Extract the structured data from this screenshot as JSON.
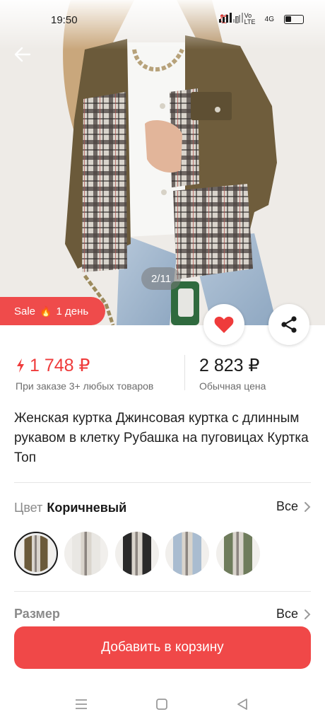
{
  "status_bar": {
    "time": "19:50",
    "network_label": "4G",
    "volte_label": "Vo LTE"
  },
  "hero": {
    "image_counter": "2/11",
    "sale_label": "Sale",
    "sale_duration": "1 день"
  },
  "prices": {
    "promo_price": "1 748 ₽",
    "promo_caption": "При заказе 3+ любых товаров",
    "regular_price": "2 823 ₽",
    "regular_caption": "Обычная цена",
    "accent_color": "#ef3b3b"
  },
  "product": {
    "title": "Женская куртка Джинсовая куртка с длинным рукавом в клетку Рубашка на пуговицах Куртка Топ"
  },
  "color_section": {
    "label": "Цвет",
    "selected_value": "Коричневый",
    "all_label": "Все",
    "swatches": [
      {
        "name": "brown",
        "color": "#6b5a3a",
        "selected": true
      },
      {
        "name": "white",
        "color": "#e9e7e3",
        "selected": false
      },
      {
        "name": "black",
        "color": "#2a2a2a",
        "selected": false
      },
      {
        "name": "light-blue",
        "color": "#a9bcd0",
        "selected": false
      },
      {
        "name": "green",
        "color": "#6f7c5c",
        "selected": false
      }
    ]
  },
  "size_section": {
    "label": "Размер",
    "all_label": "Все"
  },
  "cta": {
    "label": "Добавить в корзину",
    "color": "#f04848"
  },
  "icons": {
    "back": "arrow-left-icon",
    "favorite": "heart-icon",
    "share": "share-icon",
    "flash": "lightning-icon",
    "fire": "fire-icon",
    "chevron": "chevron-right-icon",
    "nav_menu": "menu-icon",
    "nav_home": "square-icon",
    "nav_back": "triangle-back-icon"
  }
}
